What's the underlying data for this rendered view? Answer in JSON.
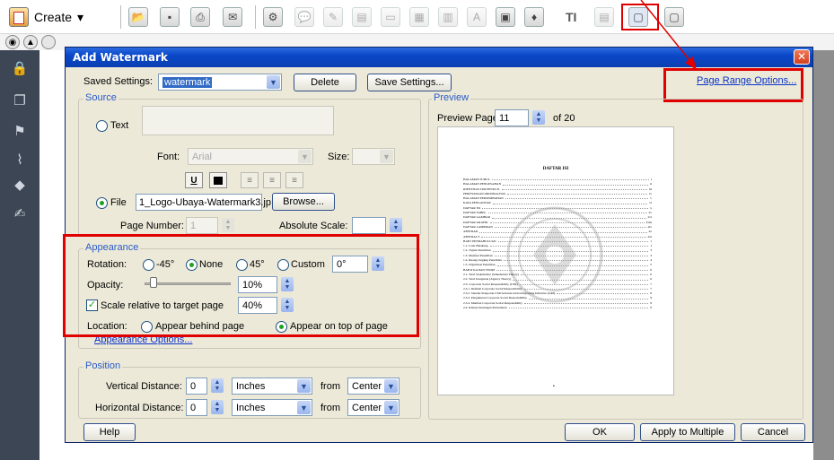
{
  "app": {
    "create_label": "Create",
    "create_arrow": "▾"
  },
  "dialog": {
    "title": "Add Watermark",
    "close_glyph": "✕",
    "saved_settings_label": "Saved Settings:",
    "saved_settings_value": "watermark",
    "delete_label": "Delete",
    "save_settings_label": "Save Settings...",
    "page_range_options_label": "Page Range Options...",
    "source": {
      "title": "Source",
      "text_label": "Text",
      "font_label": "Font:",
      "font_value": "Arial",
      "size_label": "Size:",
      "underline_glyph": "U",
      "file_label": "File",
      "file_value": "1_Logo-Ubaya-Watermark3.jp",
      "browse_label": "Browse...",
      "page_number_label": "Page Number:",
      "page_number_value": "1",
      "absolute_scale_label": "Absolute Scale:",
      "absolute_scale_value": ""
    },
    "appearance": {
      "title": "Appearance",
      "rotation_label": "Rotation:",
      "rotation_options": [
        "-45°",
        "None",
        "45°",
        "Custom"
      ],
      "rotation_custom_value": "0°",
      "opacity_label": "Opacity:",
      "opacity_value": "10%",
      "opacity_fraction": 0.1,
      "scale_relative_label": "Scale relative to target page",
      "scale_relative_value": "40%",
      "location_label": "Location:",
      "location_behind_label": "Appear behind page",
      "location_top_label": "Appear on top of page",
      "appearance_options_label": "Appearance Options..."
    },
    "position": {
      "title": "Position",
      "vertical_label": "Vertical Distance:",
      "vertical_value": "0",
      "vertical_unit": "Inches",
      "vertical_from_label": "from",
      "vertical_from_value": "Center",
      "horizontal_label": "Horizontal Distance:",
      "horizontal_value": "0",
      "horizontal_unit": "Inches",
      "horizontal_from_label": "from",
      "horizontal_from_value": "Center"
    },
    "preview": {
      "title": "Preview",
      "preview_page_label": "Preview Page",
      "preview_page_value": "11",
      "of_label": "of 20",
      "doc_title": "DAFTAR ISI",
      "toc": [
        {
          "t": "HALAMAN JUDUL",
          "p": "i"
        },
        {
          "t": "HALAMAN PENGESAHAN",
          "p": "ii"
        },
        {
          "t": "IDENTITAS TIM PENULIS",
          "p": "iii"
        },
        {
          "t": "PERNYATAAN ORISINALITAS",
          "p": "iv"
        },
        {
          "t": "HALAMAN PERSEMBAHAN",
          "p": "v"
        },
        {
          "t": "KATA PENGANTAR",
          "p": "vi"
        },
        {
          "t": "DAFTAR ISI",
          "p": "x"
        },
        {
          "t": "DAFTAR TABEL",
          "p": "xv"
        },
        {
          "t": "DAFTAR GAMBAR",
          "p": "xvi"
        },
        {
          "t": "DAFTAR GRAFIK",
          "p": "xviii"
        },
        {
          "t": "DAFTAR LAMPIRAN",
          "p": "xix"
        },
        {
          "t": "ABSTRAK",
          "p": "xx"
        },
        {
          "t": "ABSTRACT",
          "p": "xxi"
        },
        {
          "t": "BAB I   PENDAHULUAN",
          "p": "1"
        },
        {
          "t": "   1.1.  Latar Belakang",
          "p": "1"
        },
        {
          "t": "   1.2.  Tujuan Penelitian",
          "p": "3"
        },
        {
          "t": "   1.3.  Manfaat Penelitian",
          "p": "3"
        },
        {
          "t": "   1.4.  Ruang Lingkup Penelitian",
          "p": "4"
        },
        {
          "t": "   1.5.  Organisasi Penulisan",
          "p": "5"
        },
        {
          "t": "BAB II   KAJIAN TEORI",
          "p": "6"
        },
        {
          "t": "   2.1.  Teori Stakeholder (Stakeholder Theory)",
          "p": "6"
        },
        {
          "t": "   2.2.  Teori Keagenan (Agency Theory)",
          "p": "6"
        },
        {
          "t": "   2.3.  Corporate Social Responsibility (CSR)",
          "p": "7"
        },
        {
          "t": "      2.3.1.  Definisi Corporate Social Responsibility",
          "p": "7"
        },
        {
          "t": "      2.3.2.  Standar Pelaporan CSR berbasis Global Reporting Initiative (GRI)",
          "p": "8"
        },
        {
          "t": "      2.3.3.  Pengukuran Corporate Social Responsibility",
          "p": "9"
        },
        {
          "t": "      2.3.4.  Manfaat Corporate Social Responsibility",
          "p": "9"
        },
        {
          "t": "   2.4.  Kinerja Keuangan Perusahaan",
          "p": "9"
        }
      ]
    },
    "help_label": "Help",
    "ok_label": "OK",
    "apply_multiple_label": "Apply to Multiple",
    "cancel_label": "Cancel"
  },
  "colors": {
    "annotation_red": "#e00000",
    "dialog_bg": "#ece9d8",
    "titlebar_blue": "#0a48c8",
    "group_title_blue": "#2a5bc8"
  }
}
